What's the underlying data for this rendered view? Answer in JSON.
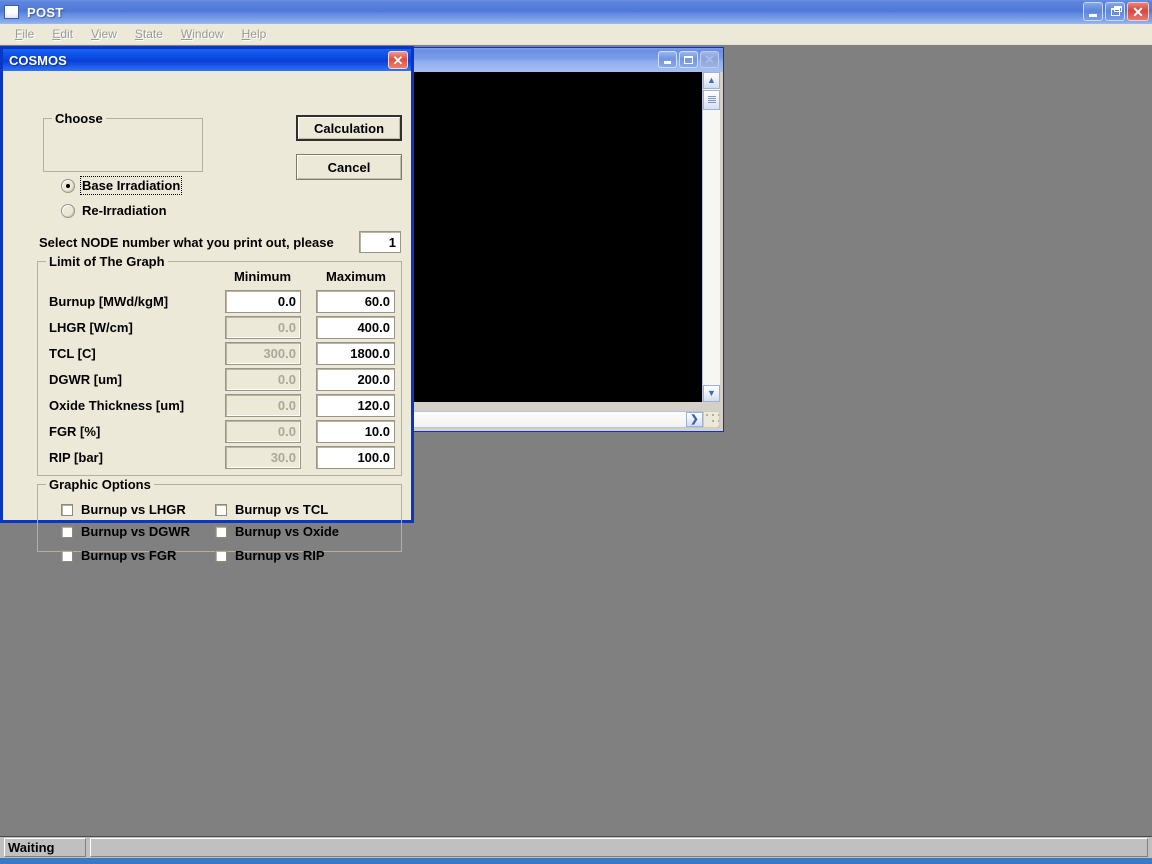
{
  "app": {
    "title": "POST",
    "icon": "app-window-icon",
    "titlebar_buttons": [
      {
        "name": "minimize",
        "glyph": "_"
      },
      {
        "name": "restore",
        "glyph": "❐"
      },
      {
        "name": "close",
        "glyph": "✕"
      }
    ],
    "menu": [
      {
        "mnemonic": "F",
        "rest": "ile"
      },
      {
        "mnemonic": "E",
        "rest": "dit"
      },
      {
        "mnemonic": "V",
        "rest": "iew"
      },
      {
        "mnemonic": "S",
        "rest": "tate"
      },
      {
        "mnemonic": "W",
        "rest": "indow"
      },
      {
        "mnemonic": "H",
        "rest": "elp"
      }
    ]
  },
  "child_window": {
    "title": "",
    "buttons": [
      {
        "name": "minimize",
        "glyph": "_",
        "enabled": true
      },
      {
        "name": "maximize",
        "glyph": "□",
        "enabled": true
      },
      {
        "name": "close",
        "glyph": "✕",
        "enabled": false
      }
    ],
    "canvas_color": "#000000",
    "vscroll_up": "⌃",
    "vscroll_down": "⌄",
    "hscroll_right": "❯"
  },
  "dialog": {
    "title": "COSMOS",
    "close_glyph": "✕",
    "choose_group": {
      "legend": "Choose",
      "options": [
        {
          "label": "Base Irradiation",
          "selected": true,
          "focused": true
        },
        {
          "label": "Re-Irradiation",
          "selected": false,
          "focused": false
        }
      ]
    },
    "buttons": {
      "calculation": "Calculation",
      "cancel": "Cancel"
    },
    "node": {
      "label": "Select NODE number what you print out, please",
      "value": "1"
    },
    "limit_group": {
      "legend": "Limit of The Graph",
      "headers": [
        "Minimum",
        "Maximum"
      ],
      "rows": [
        {
          "label": "Burnup [MWd/kgM]",
          "min": "0.0",
          "min_enabled": true,
          "max": "60.0",
          "max_enabled": true
        },
        {
          "label": "LHGR [W/cm]",
          "min": "0.0",
          "min_enabled": false,
          "max": "400.0",
          "max_enabled": true
        },
        {
          "label": "TCL [C]",
          "min": "300.0",
          "min_enabled": false,
          "max": "1800.0",
          "max_enabled": true
        },
        {
          "label": "DGWR [um]",
          "min": "0.0",
          "min_enabled": false,
          "max": "200.0",
          "max_enabled": true
        },
        {
          "label": "Oxide Thickness [um]",
          "min": "0.0",
          "min_enabled": false,
          "max": "120.0",
          "max_enabled": true
        },
        {
          "label": "FGR [%]",
          "min": "0.0",
          "min_enabled": false,
          "max": "10.0",
          "max_enabled": true
        },
        {
          "label": "RIP [bar]",
          "min": "30.0",
          "min_enabled": false,
          "max": "100.0",
          "max_enabled": true
        }
      ]
    },
    "graphic_options": {
      "legend": "Graphic Options",
      "items": [
        {
          "label": "Burnup vs LHGR",
          "checked": false
        },
        {
          "label": "Burnup vs TCL",
          "checked": false
        },
        {
          "label": "Burnup vs DGWR",
          "checked": false
        },
        {
          "label": "Burnup vs Oxide",
          "checked": false
        },
        {
          "label": "Burnup vs FGR",
          "checked": false
        },
        {
          "label": "Burnup vs RIP",
          "checked": false
        }
      ]
    }
  },
  "statusbar": {
    "left_text": "Waiting",
    "right_text": ""
  },
  "colors": {
    "desktop": "#808080",
    "dialog_face": "#ece9d8",
    "dialog_border": "#0a36c8",
    "titlebar_blue": "#0a46e0",
    "canvas_black": "#000000",
    "statusbar_face": "#c0c0c0"
  }
}
